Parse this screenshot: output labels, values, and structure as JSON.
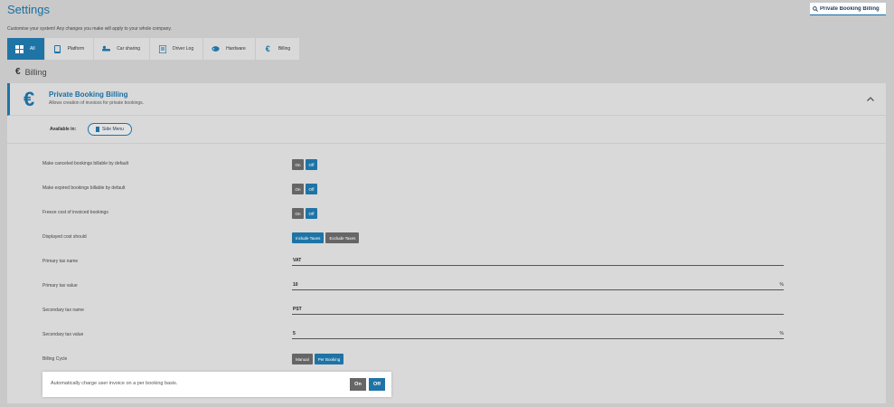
{
  "page": {
    "title": "Settings",
    "subtitle": "Customise your system! Any changes you make will apply to your whole company."
  },
  "search": {
    "value": "Private Booking Billing",
    "icon": "search-icon"
  },
  "tabs": [
    {
      "label": "All",
      "icon": "grid-icon",
      "active": true
    },
    {
      "label": "Platform",
      "icon": "tablet-icon",
      "active": false
    },
    {
      "label": "Car sharing",
      "icon": "car-sharing-icon",
      "active": false
    },
    {
      "label": "Driver Log",
      "icon": "log-icon",
      "active": false
    },
    {
      "label": "Hardware",
      "icon": "hardware-icon",
      "active": false
    },
    {
      "label": "Billing",
      "icon": "euro-icon",
      "active": false
    }
  ],
  "section": {
    "icon_glyph": "€",
    "heading": "Billing"
  },
  "panel": {
    "icon_glyph": "€",
    "title": "Private Booking Billing",
    "description": "Allows creation of invoices for private bookings.",
    "available_label": "Available in:",
    "available_pill": "Side Menu"
  },
  "settings": {
    "canceled": {
      "label": "Make canceled bookings billable by default",
      "on": "On",
      "off": "Off",
      "selected": "Off"
    },
    "expired": {
      "label": "Make expired bookings billable by default",
      "on": "On",
      "off": "Off",
      "selected": "Off"
    },
    "freeze": {
      "label": "Freeze cost of invoiced bookings",
      "on": "On",
      "off": "Off",
      "selected": "Off"
    },
    "displayed_cost": {
      "label": "Displayed cost should",
      "include": "Include Taxes",
      "exclude": "Exclude Taxes",
      "selected": "Include Taxes"
    },
    "primary_tax_name": {
      "label": "Primary tax name",
      "value": "VAT"
    },
    "primary_tax_value": {
      "label": "Primary tax value",
      "value": "10",
      "unit": "%"
    },
    "secondary_tax_name": {
      "label": "Secondary tax name",
      "value": "PST"
    },
    "secondary_tax_value": {
      "label": "Secondary tax value",
      "value": "5",
      "unit": "%"
    },
    "billing_cycle": {
      "label": "Billing Cycle",
      "manual": "Manual",
      "per_booking": "Per Booking",
      "selected": "Per Booking"
    }
  },
  "popup": {
    "text": "Automatically charge user invoice on a per booking basis.",
    "on": "On",
    "off": "Off",
    "selected": "Off"
  },
  "colors": {
    "accent": "#1f74a6",
    "background": "#c9c9c9",
    "panel": "#d9d9d9",
    "button_gray": "#666666"
  }
}
